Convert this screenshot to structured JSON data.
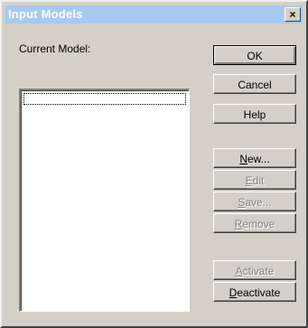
{
  "window": {
    "title": "Input Models",
    "close_glyph": "×"
  },
  "current_model_label": "Current Model:",
  "listbox": {
    "items": []
  },
  "buttons": {
    "ok": "OK",
    "cancel": "Cancel",
    "help": "Help",
    "new": {
      "accel": "N",
      "rest": "ew..."
    },
    "edit": {
      "accel": "E",
      "rest": "dit"
    },
    "save": {
      "accel": "S",
      "rest": "ave..."
    },
    "remove": {
      "accel": "R",
      "rest": "emove"
    },
    "activate": {
      "accel": "A",
      "rest": "ctivate"
    },
    "deactivate": {
      "accel": "D",
      "rest": "eactivate"
    }
  },
  "colors": {
    "titlebar": "#a6caf0",
    "face": "#d4d0c8",
    "disabled_text": "#808080"
  }
}
